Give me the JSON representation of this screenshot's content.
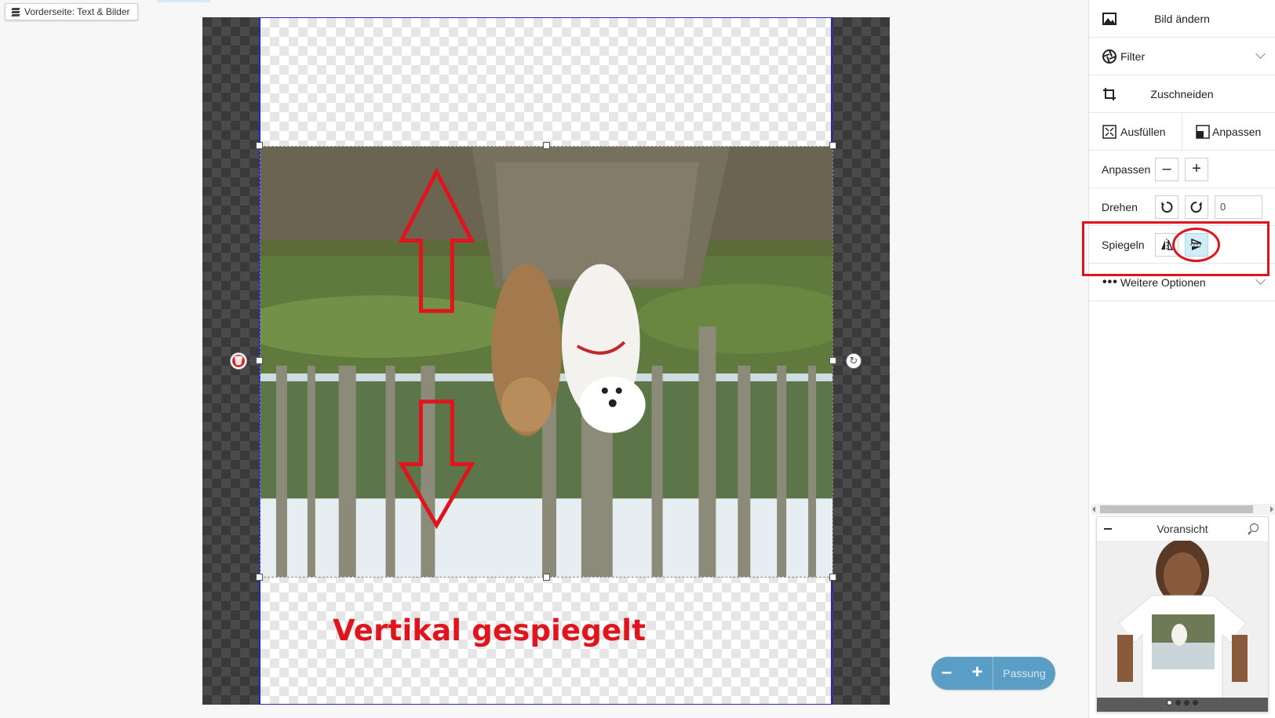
{
  "layer_chip": {
    "label": "Vorderseite: Text & Bilder",
    "icon": "layers-icon"
  },
  "canvas": {
    "annotation_text": "Vertikal gespiegelt",
    "annotation_color": "#e0141c",
    "delete_icon": "trash-icon",
    "rotate_icon": "rotate-icon"
  },
  "zoom": {
    "minus": "–",
    "plus": "+",
    "fit": "Passung"
  },
  "panel": {
    "change_image": {
      "label": "Bild ändern",
      "icon": "image-icon"
    },
    "filter": {
      "label": "Filter",
      "icon": "aperture-icon"
    },
    "crop": {
      "label": "Zuschneiden",
      "icon": "crop-icon"
    },
    "fill": {
      "label": "Ausfüllen",
      "icon": "fill-icon"
    },
    "fit": {
      "label": "Anpassen",
      "icon": "fit-icon"
    },
    "scale": {
      "label": "Anpassen",
      "minus": "–",
      "plus": "+"
    },
    "rotate": {
      "label": "Drehen",
      "value": "0"
    },
    "mirror": {
      "label": "Spiegeln"
    },
    "more": {
      "label": "Weitere Optionen",
      "icon": "more-icon"
    }
  },
  "preview": {
    "title": "Voransicht",
    "active_dot": 0,
    "dot_count": 4
  },
  "colors": {
    "accent_blue": "#5a9ec6",
    "active_button": "#cfeef7",
    "print_border": "#2626c8"
  }
}
